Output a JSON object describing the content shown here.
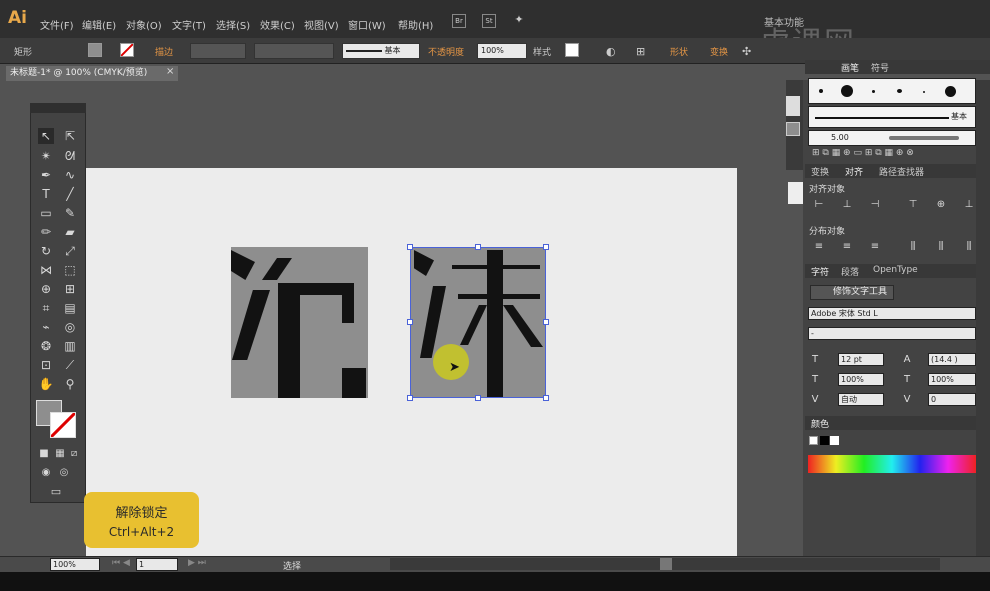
{
  "app": {
    "logo": "Ai"
  },
  "menu": [
    "文件(F)",
    "编辑(E)",
    "对象(O)",
    "文字(T)",
    "选择(S)",
    "效果(C)",
    "视图(V)",
    "窗口(W)",
    "帮助(H)"
  ],
  "workspace_label": "基本功能",
  "watermark": "虎课网",
  "control_bar": {
    "shape": "矩形",
    "stroke_label": "描边",
    "stroke_style": "基本",
    "opacity_label": "不透明度",
    "opacity_value": "100%",
    "style_label": "样式",
    "shape_link": "形状",
    "transform_link": "变换"
  },
  "document": {
    "tab_title": "未标题-1* @ 100% (CMYK/预览)"
  },
  "hint": {
    "title": "解除锁定",
    "shortcut": "Ctrl+Alt+2"
  },
  "status": {
    "zoom": "100%",
    "page": "1",
    "tool": "选择"
  },
  "panels": {
    "brush": {
      "tabs": [
        "画笔",
        "符号"
      ],
      "stroke_name": "基本",
      "size": "5.00"
    },
    "align": {
      "tabs": [
        "变换",
        "对齐",
        "路径查找器"
      ],
      "align_objects": "对齐对象",
      "distribute_objects": "分布对象"
    },
    "character": {
      "tabs": [
        "字符",
        "段落",
        "OpenType"
      ],
      "touch_type": "修饰文字工具",
      "font_family": "Adobe 宋体 Std L",
      "font_style": "-",
      "font_size": "12 pt",
      "leading": "(14.4 )",
      "h_scale": "100%",
      "v_scale": "100%",
      "kerning": "自动",
      "tracking": "0"
    },
    "color": {
      "tab": "颜色"
    }
  },
  "colors": {
    "accent": "#e39545",
    "selection": "#4a62d8",
    "hint_bg": "#e8c030"
  }
}
